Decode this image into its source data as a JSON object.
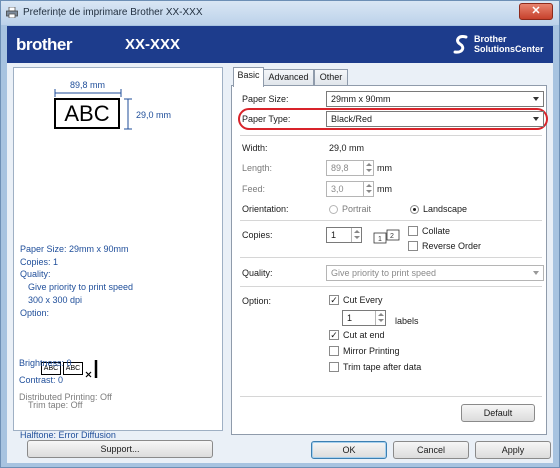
{
  "window": {
    "title": "Preferințe de imprimare Brother XX-XXX",
    "close_glyph": "✕"
  },
  "banner": {
    "brand": "brother",
    "model": "XX-XXX",
    "sc_line1": "Brother",
    "sc_line2": "SolutionsCenter"
  },
  "preview": {
    "width_label": "89,8 mm",
    "height_label": "29,0 mm",
    "label_text": "ABC"
  },
  "summary": {
    "paper_size": "Paper Size: 29mm x 90mm",
    "copies": "Copies: 1",
    "quality_heading": "Quality:",
    "quality_value": "Give priority to print speed",
    "resolution": "300 x 300 dpi",
    "option_heading": "Option:",
    "mini_label": "ABC",
    "trim_tape": "Trim tape: Off",
    "halftone": "Halftone: Error Diffusion",
    "brightness": "Brightness:  0",
    "contrast": "Contrast:  0",
    "distributed": "Distributed Printing: Off"
  },
  "support_button": "Support...",
  "tabs": [
    {
      "label": "Basic",
      "active": true
    },
    {
      "label": "Advanced",
      "active": false
    },
    {
      "label": "Other",
      "active": false
    }
  ],
  "basic": {
    "paper_size_label": "Paper Size:",
    "paper_size_value": "29mm x 90mm",
    "paper_type_label": "Paper Type:",
    "paper_type_value": "Black/Red",
    "width_label": "Width:",
    "width_value": "29,0 mm",
    "length_label": "Length:",
    "length_value": "89,8",
    "length_unit": "mm",
    "feed_label": "Feed:",
    "feed_value": "3,0",
    "feed_unit": "mm",
    "orientation_label": "Orientation:",
    "portrait_label": "Portrait",
    "landscape_label": "Landscape",
    "orientation_selected": "Landscape",
    "copies_label": "Copies:",
    "copies_value": "1",
    "collate_label": "Collate",
    "reverse_order_label": "Reverse Order",
    "quality_label": "Quality:",
    "quality_value": "Give priority to print speed",
    "option_label": "Option:",
    "cut_every_label": "Cut Every",
    "cut_every_value": "1",
    "labels_unit": "labels",
    "cut_at_end_label": "Cut at end",
    "mirror_label": "Mirror Printing",
    "trim_after_label": "Trim tape after data",
    "default_button": "Default"
  },
  "checks": {
    "cut_every": true,
    "cut_at_end": true,
    "collate": false,
    "reverse_order": false,
    "mirror": false,
    "trim_after": false,
    "check_glyph": "✓"
  },
  "footer": {
    "ok": "OK",
    "cancel": "Cancel",
    "apply": "Apply"
  },
  "colors": {
    "banner": "#1d3c8c",
    "highlight": "#d8232a",
    "accent_text": "#1f4e9a"
  }
}
